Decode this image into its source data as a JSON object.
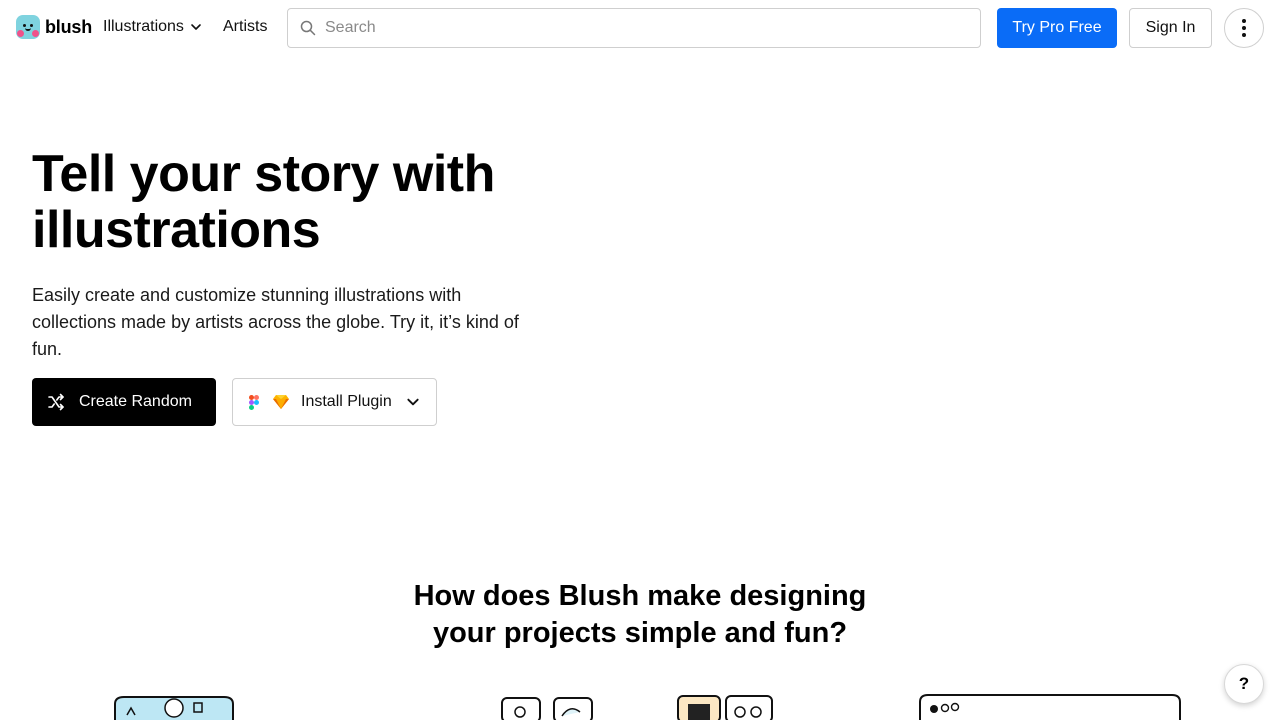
{
  "brand": {
    "name": "blush"
  },
  "nav": {
    "illustrations_label": "Illustrations",
    "artists_label": "Artists"
  },
  "search": {
    "placeholder": "Search"
  },
  "actions": {
    "pro_label": "Try Pro Free",
    "signin_label": "Sign In"
  },
  "hero": {
    "title_line1": "Tell your story with",
    "title_line2": "illustrations",
    "subtitle": "Easily create and customize stunning illustrations with collections made by artists across the globe. Try it, it’s kind of fun.",
    "create_random_label": "Create Random",
    "install_plugin_label": "Install Plugin"
  },
  "section": {
    "title_line1": "How does Blush make designing",
    "title_line2": "your projects simple and fun?"
  },
  "help": {
    "label": "?"
  },
  "colors": {
    "primary": "#0a6cf7",
    "dark": "#000000",
    "border": "#cfcfcf",
    "logo_teal": "#7fd3df",
    "logo_pink": "#f0528a"
  },
  "icons": [
    "logo-icon",
    "chevron-down-icon",
    "search-icon",
    "more-vertical-icon",
    "shuffle-icon",
    "figma-icon",
    "sketch-icon",
    "help-icon"
  ]
}
